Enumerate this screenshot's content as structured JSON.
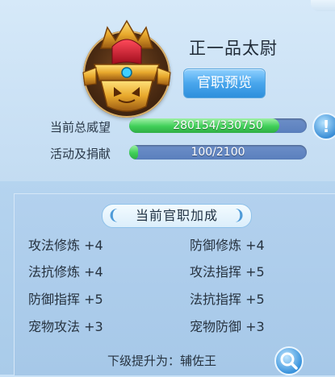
{
  "rank": {
    "title": "正一品太尉",
    "preview_button": "官职预览"
  },
  "stats": {
    "prestige_label": "当前总威望",
    "prestige_text": "280154/330750",
    "prestige_progress": 0.847,
    "contribution_label": "活动及捐献",
    "contribution_text": "100/2100",
    "contribution_progress": 0.048,
    "help_glyph": "!"
  },
  "bonus_section": {
    "title": "当前官职加成",
    "items": [
      {
        "name": "攻法修炼",
        "value": "+4"
      },
      {
        "name": "防御修炼",
        "value": "+4"
      },
      {
        "name": "法抗修炼",
        "value": "+4"
      },
      {
        "name": "攻法指挥",
        "value": "+5"
      },
      {
        "name": "防御指挥",
        "value": "+5"
      },
      {
        "name": "法抗指挥",
        "value": "+5"
      },
      {
        "name": "宠物攻法",
        "value": "+3"
      },
      {
        "name": "宠物防御",
        "value": "+3"
      }
    ]
  },
  "footer": {
    "next_label": "下级提升为：",
    "next_rank": "辅佐王"
  },
  "icons": {
    "emblem": "golden-helmet-icon",
    "search": "magnifier-icon",
    "help": "exclamation-icon"
  }
}
